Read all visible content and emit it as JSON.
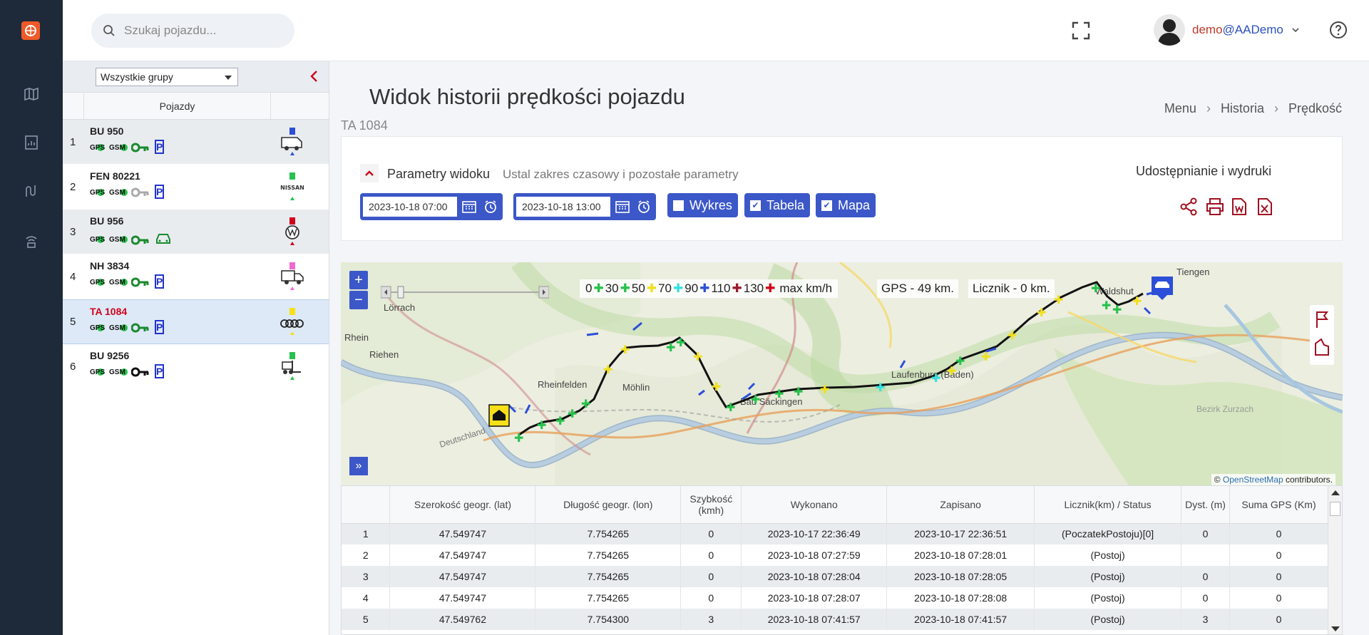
{
  "search": {
    "placeholder": "Szukaj pojazdu..."
  },
  "user": {
    "name": "demo",
    "company": "@AADemo"
  },
  "groups": {
    "selected": "Wszystkie grupy"
  },
  "vehicle_list": {
    "header": "Pojazdy",
    "items": [
      {
        "num": "1",
        "reg": "BU 950",
        "gps": "GPS",
        "gsm": "GSM",
        "key_color": "#1a8a2e",
        "status": "P",
        "brand_icon": "van-icon"
      },
      {
        "num": "2",
        "reg": "FEN 80221",
        "gps": "GPS",
        "gsm": "GSM",
        "key_color": "#aaaaaa",
        "status": "P",
        "brand_icon": "nissan-logo"
      },
      {
        "num": "3",
        "reg": "BU 956",
        "gps": "GPS",
        "gsm": "GSM",
        "key_color": "#1a8a2e",
        "status": "car",
        "brand_icon": "vw-logo"
      },
      {
        "num": "4",
        "reg": "NH 3834",
        "gps": "GPS",
        "gsm": "GSM",
        "key_color": "#1a8a2e",
        "status": "P",
        "brand_icon": "truck-icon"
      },
      {
        "num": "5",
        "reg": "TA 1084",
        "gps": "GPS",
        "gsm": "GSM",
        "key_color": "#1a8a2e",
        "status": "P",
        "brand_icon": "audi-logo"
      },
      {
        "num": "6",
        "reg": "BU 9256",
        "gps": "GPS",
        "gsm": "GSM",
        "key_color": "#111111",
        "status": "P",
        "brand_icon": "forklift-icon"
      }
    ]
  },
  "page": {
    "title": "Widok historii prędkości pojazdu",
    "vehicle": "TA 1084",
    "breadcrumb": [
      "Menu",
      "Historia",
      "Prędkość"
    ]
  },
  "params": {
    "title": "Parametry widoku",
    "subtitle": "Ustal zakres czasowy i pozostałe parametry",
    "date_from": "2023-10-18 07:00",
    "date_to": "2023-10-18 13:00",
    "chart_label": "Wykres",
    "table_label": "Tabela",
    "map_label": "Mapa",
    "chart_checked": false,
    "table_checked": true,
    "map_checked": true,
    "share_title": "Udostępnianie i wydruki"
  },
  "map": {
    "legend": [
      {
        "value": "0",
        "color": "#27c24c"
      },
      {
        "value": "30",
        "color": "#27c24c"
      },
      {
        "value": "50",
        "color": "#f0e020"
      },
      {
        "value": "70",
        "color": "#36e0e0"
      },
      {
        "value": "90",
        "color": "#2b4fd8"
      },
      {
        "value": "110",
        "color": "#9b1b30"
      },
      {
        "value": "130",
        "color": "#d0021b"
      }
    ],
    "legend_unit": "max km/h",
    "gps_distance": "GPS - 49 km.",
    "counter": "Licznik - 0 km.",
    "places": [
      "Lörrach",
      "Rhein",
      "Riehen",
      "Rheinfelden",
      "Möhlin",
      "Bad Säckingen",
      "Laufenburg (Baden)",
      "Waldshut",
      "Tiengen",
      "Deutschland",
      "Bezirk Zurzach"
    ],
    "attribution": "© ",
    "attribution_link": "OpenStreetMap",
    "attribution_suffix": " contributors."
  },
  "table": {
    "headers": [
      "",
      "Szerokość geogr. (lat)",
      "Długość geogr. (lon)",
      "Szybkość (kmh)",
      "Wykonano",
      "Zapisano",
      "Licznik(km) / Status",
      "Dyst. (m)",
      "Suma GPS (Km)"
    ],
    "rows": [
      [
        "1",
        "47.549747",
        "7.754265",
        "0",
        "2023-10-17 22:36:49",
        "2023-10-17 22:36:51",
        "(PoczatekPostoju)[0]",
        "0",
        "0"
      ],
      [
        "2",
        "47.549747",
        "7.754265",
        "0",
        "2023-10-18 07:27:59",
        "2023-10-18 07:28:01",
        "(Postoj)",
        "",
        "0"
      ],
      [
        "3",
        "47.549747",
        "7.754265",
        "0",
        "2023-10-18 07:28:04",
        "2023-10-18 07:28:05",
        "(Postoj)",
        "0",
        "0"
      ],
      [
        "4",
        "47.549747",
        "7.754265",
        "0",
        "2023-10-18 07:28:07",
        "2023-10-18 07:28:08",
        "(Postoj)",
        "0",
        "0"
      ],
      [
        "5",
        "47.549762",
        "7.754300",
        "3",
        "2023-10-18 07:41:57",
        "2023-10-18 07:41:57",
        "(Postoj)",
        "3",
        "0"
      ]
    ]
  }
}
